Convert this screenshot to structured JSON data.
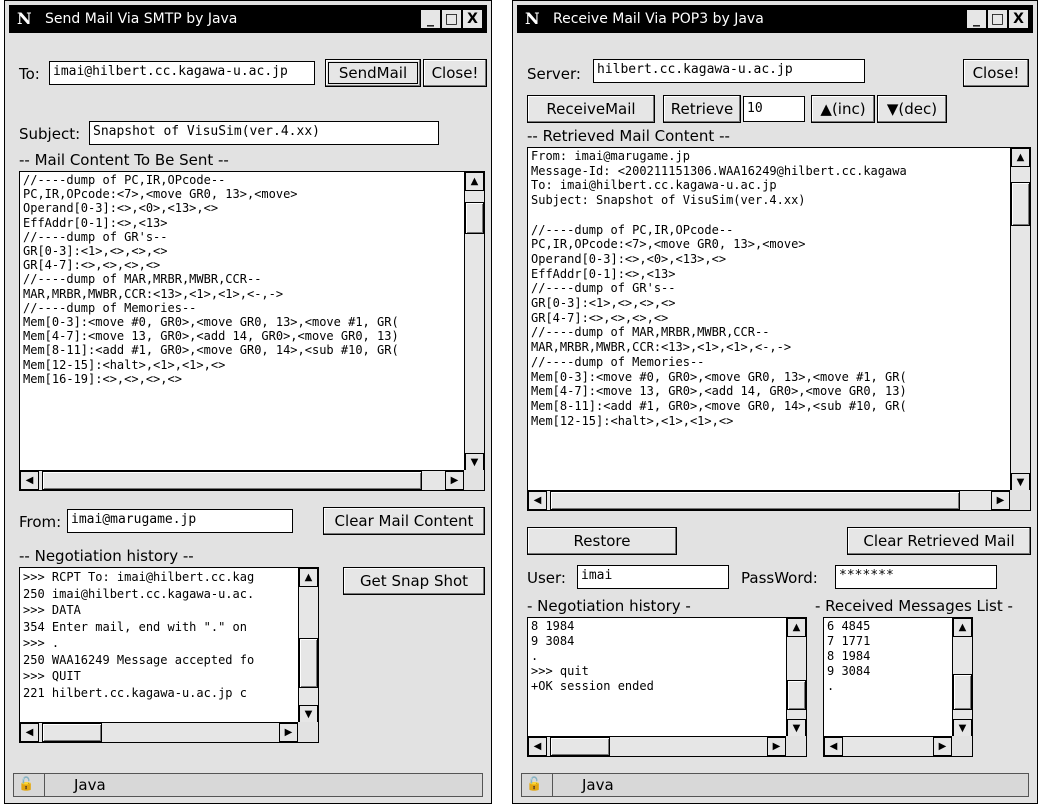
{
  "send": {
    "logo": "N",
    "title": "Send Mail Via SMTP by Java",
    "min": "_",
    "max": "□",
    "close_x": "X",
    "to_label": "To:",
    "to_value": "imai@hilbert.cc.kagawa-u.ac.jp",
    "sendmail": "SendMail",
    "close": "Close!",
    "subject_label": "Subject:",
    "subject_value": "Snapshot of VisuSim(ver.4.xx)",
    "content_label": "-- Mail Content To Be Sent --",
    "content_text": "//----dump of PC,IR,OPcode--\nPC,IR,OPcode:<7>,<move GR0, 13>,<move>\nOperand[0-3]:<>,<0>,<13>,<>\nEffAddr[0-1]:<>,<13>\n//----dump of GR's--\nGR[0-3]:<1>,<>,<>,<>\nGR[4-7]:<>,<>,<>,<>\n//----dump of MAR,MRBR,MWBR,CCR--\nMAR,MRBR,MWBR,CCR:<13>,<1>,<1>,<-,->\n//----dump of Memories--\nMem[0-3]:<move #0, GR0>,<move GR0, 13>,<move #1, GR(\nMem[4-7]:<move 13, GR0>,<add 14, GR0>,<move GR0, 13)\nMem[8-11]:<add #1, GR0>,<move GR0, 14>,<sub #10, GR(\nMem[12-15]:<halt>,<1>,<1>,<>\nMem[16-19]:<>,<>,<>,<>",
    "from_label": "From:",
    "from_value": "imai@marugame.jp",
    "clear_content": "Clear Mail Content",
    "negotiation_label": "-- Negotiation history --",
    "negotiation_text": ">>> RCPT To: imai@hilbert.cc.kag\n250 imai@hilbert.cc.kagawa-u.ac.\n>>> DATA\n354 Enter mail, end with \".\" on\n>>> .\n250 WAA16249 Message accepted fo\n>>> QUIT\n221 hilbert.cc.kagawa-u.ac.jp c",
    "snapshot": "Get Snap Shot",
    "status": "Java"
  },
  "receive": {
    "logo": "N",
    "title": "Receive Mail Via POP3 by Java",
    "min": "_",
    "max": "□",
    "close_x": "X",
    "server_label": "Server:",
    "server_value": "hilbert.cc.kagawa-u.ac.jp",
    "close": "Close!",
    "receivemail": "ReceiveMail",
    "retrieve": "Retrieve",
    "retrieve_num": "10",
    "inc": "▲(inc)",
    "dec": "▼(dec)",
    "content_label": "-- Retrieved Mail Content --",
    "content_text": "From: imai@marugame.jp\nMessage-Id: <200211151306.WAA16249@hilbert.cc.kagawa\nTo: imai@hilbert.cc.kagawa-u.ac.jp\nSubject: Snapshot of VisuSim(ver.4.xx)\n\n//----dump of PC,IR,OPcode--\nPC,IR,OPcode:<7>,<move GR0, 13>,<move>\nOperand[0-3]:<>,<0>,<13>,<>\nEffAddr[0-1]:<>,<13>\n//----dump of GR's--\nGR[0-3]:<1>,<>,<>,<>\nGR[4-7]:<>,<>,<>,<>\n//----dump of MAR,MRBR,MWBR,CCR--\nMAR,MRBR,MWBR,CCR:<13>,<1>,<1>,<-,->\n//----dump of Memories--\nMem[0-3]:<move #0, GR0>,<move GR0, 13>,<move #1, GR(\nMem[4-7]:<move 13, GR0>,<add 14, GR0>,<move GR0, 13)\nMem[8-11]:<add #1, GR0>,<move GR0, 14>,<sub #10, GR(\nMem[12-15]:<halt>,<1>,<1>,<>",
    "restore": "Restore",
    "clear_retrieved": "Clear Retrieved Mail",
    "user_label": "User:",
    "user_value": "imai",
    "password_label": "PassWord:",
    "password_value": "*******",
    "negotiation_label": "- Negotiation history -",
    "negotiation_text": "8 1984\n9 3084\n.\n>>> quit\n+OK session ended",
    "messages_label": "- Received Messages List -",
    "messages_text": "6 4845\n7 1771\n8 1984\n9 3084\n.",
    "status": "Java"
  }
}
